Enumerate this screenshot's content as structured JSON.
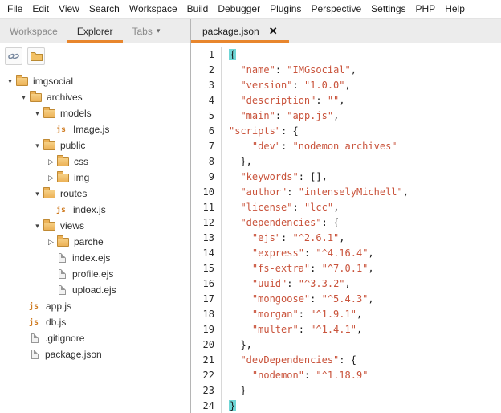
{
  "colors": {
    "accent": "#e8862d",
    "code_string": "#c9533b",
    "brace_highlight": "#6fd6d6"
  },
  "icons": {
    "expanded_glyph": "▾",
    "collapsed_glyph": "▷",
    "chevron_down_glyph": "▾",
    "close_glyph": "✕",
    "js_badge": "js"
  },
  "menu_bar": {
    "items": [
      "File",
      "Edit",
      "View",
      "Search",
      "Workspace",
      "Build",
      "Debugger",
      "Plugins",
      "Perspective",
      "Settings",
      "PHP",
      "Help"
    ]
  },
  "panel_tabs": [
    {
      "label": "Workspace",
      "active": false,
      "dropdown": false
    },
    {
      "label": "Explorer",
      "active": true,
      "dropdown": false
    },
    {
      "label": "Tabs",
      "active": false,
      "dropdown": true
    }
  ],
  "editor_tabs": [
    {
      "label": "package.json",
      "active": true
    }
  ],
  "sidebar_toolbar": [
    {
      "name": "link-icon"
    },
    {
      "name": "folder-icon"
    }
  ],
  "file_tree": [
    {
      "label": "imgsocial",
      "depth": 0,
      "type": "folder",
      "expanded": true
    },
    {
      "label": "archives",
      "depth": 1,
      "type": "folder",
      "expanded": true
    },
    {
      "label": "models",
      "depth": 2,
      "type": "folder",
      "expanded": true
    },
    {
      "label": "Image.js",
      "depth": 3,
      "type": "js-file"
    },
    {
      "label": "public",
      "depth": 2,
      "type": "folder",
      "expanded": true
    },
    {
      "label": "css",
      "depth": 3,
      "type": "folder",
      "expanded": false
    },
    {
      "label": "img",
      "depth": 3,
      "type": "folder",
      "expanded": false
    },
    {
      "label": "routes",
      "depth": 2,
      "type": "folder",
      "expanded": true
    },
    {
      "label": "index.js",
      "depth": 3,
      "type": "js-file"
    },
    {
      "label": "views",
      "depth": 2,
      "type": "folder",
      "expanded": true
    },
    {
      "label": "parche",
      "depth": 3,
      "type": "folder",
      "expanded": false
    },
    {
      "label": "index.ejs",
      "depth": 3,
      "type": "file"
    },
    {
      "label": "profile.ejs",
      "depth": 3,
      "type": "file"
    },
    {
      "label": "upload.ejs",
      "depth": 3,
      "type": "file"
    },
    {
      "label": "app.js",
      "depth": 1,
      "type": "js-file"
    },
    {
      "label": "db.js",
      "depth": 1,
      "type": "js-file"
    },
    {
      "label": ".gitignore",
      "depth": 1,
      "type": "file"
    },
    {
      "label": "package.json",
      "depth": 1,
      "type": "file"
    }
  ],
  "editor": {
    "file": "package.json",
    "lines": [
      {
        "n": 1,
        "text": "{",
        "brace_highlight": true
      },
      {
        "n": 2,
        "text": "  \"name\": \"IMGsocial\","
      },
      {
        "n": 3,
        "text": "  \"version\": \"1.0.0\","
      },
      {
        "n": 4,
        "text": "  \"description\": \"\","
      },
      {
        "n": 5,
        "text": "  \"main\": \"app.js\","
      },
      {
        "n": 6,
        "text": "\"scripts\": {"
      },
      {
        "n": 7,
        "text": "    \"dev\": \"nodemon archives\""
      },
      {
        "n": 8,
        "text": "  },"
      },
      {
        "n": 9,
        "text": "  \"keywords\": [],"
      },
      {
        "n": 10,
        "text": "  \"author\": \"intenselyMichell\","
      },
      {
        "n": 11,
        "text": "  \"license\": \"lcc\","
      },
      {
        "n": 12,
        "text": "  \"dependencies\": {"
      },
      {
        "n": 13,
        "text": "    \"ejs\": \"^2.6.1\","
      },
      {
        "n": 14,
        "text": "    \"express\": \"^4.16.4\","
      },
      {
        "n": 15,
        "text": "    \"fs-extra\": \"^7.0.1\","
      },
      {
        "n": 16,
        "text": "    \"uuid\": \"^3.3.2\","
      },
      {
        "n": 17,
        "text": "    \"mongoose\": \"^5.4.3\","
      },
      {
        "n": 18,
        "text": "    \"morgan\": \"^1.9.1\","
      },
      {
        "n": 19,
        "text": "    \"multer\": \"^1.4.1\","
      },
      {
        "n": 20,
        "text": "  },"
      },
      {
        "n": 21,
        "text": "  \"devDependencies\": {"
      },
      {
        "n": 22,
        "text": "    \"nodemon\": \"^1.18.9\""
      },
      {
        "n": 23,
        "text": "  }"
      },
      {
        "n": 24,
        "text": "}",
        "brace_highlight": true
      }
    ]
  }
}
